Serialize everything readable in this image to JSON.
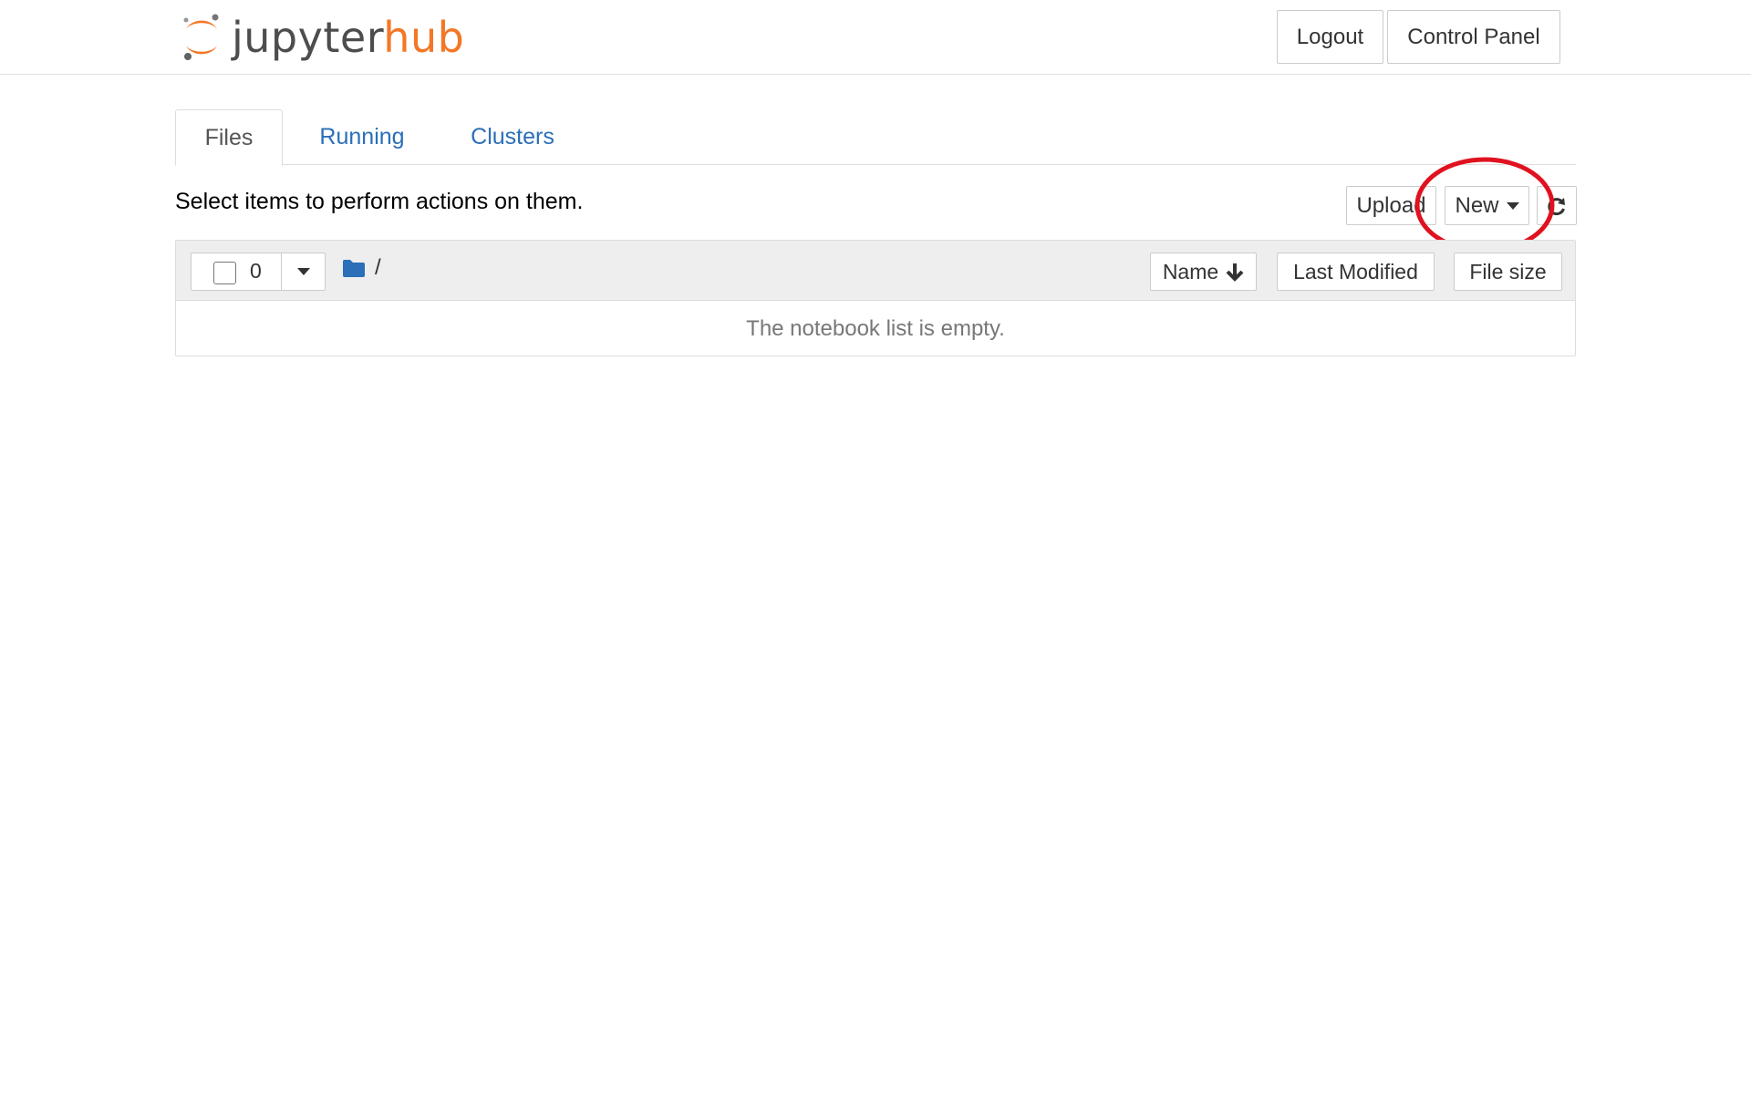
{
  "header": {
    "logo_jupyter": "jupyter",
    "logo_hub": "hub",
    "logout_label": "Logout",
    "control_panel_label": "Control Panel"
  },
  "tabs": [
    {
      "label": "Files",
      "active": true
    },
    {
      "label": "Running",
      "active": false
    },
    {
      "label": "Clusters",
      "active": false
    }
  ],
  "toolbar": {
    "instruction": "Select items to perform actions on them.",
    "upload_label": "Upload",
    "new_label": "New",
    "refresh_icon": "refresh-icon"
  },
  "file_list": {
    "selected_count": "0",
    "breadcrumb_path": "/",
    "sort_name_label": "Name",
    "sort_modified_label": "Last Modified",
    "sort_size_label": "File size",
    "empty_message": "The notebook list is empty."
  },
  "colors": {
    "brand_orange": "#f37726",
    "link_blue": "#2a6fb8",
    "folder_blue": "#2a6fb8",
    "annotation_red": "#e0121f"
  }
}
